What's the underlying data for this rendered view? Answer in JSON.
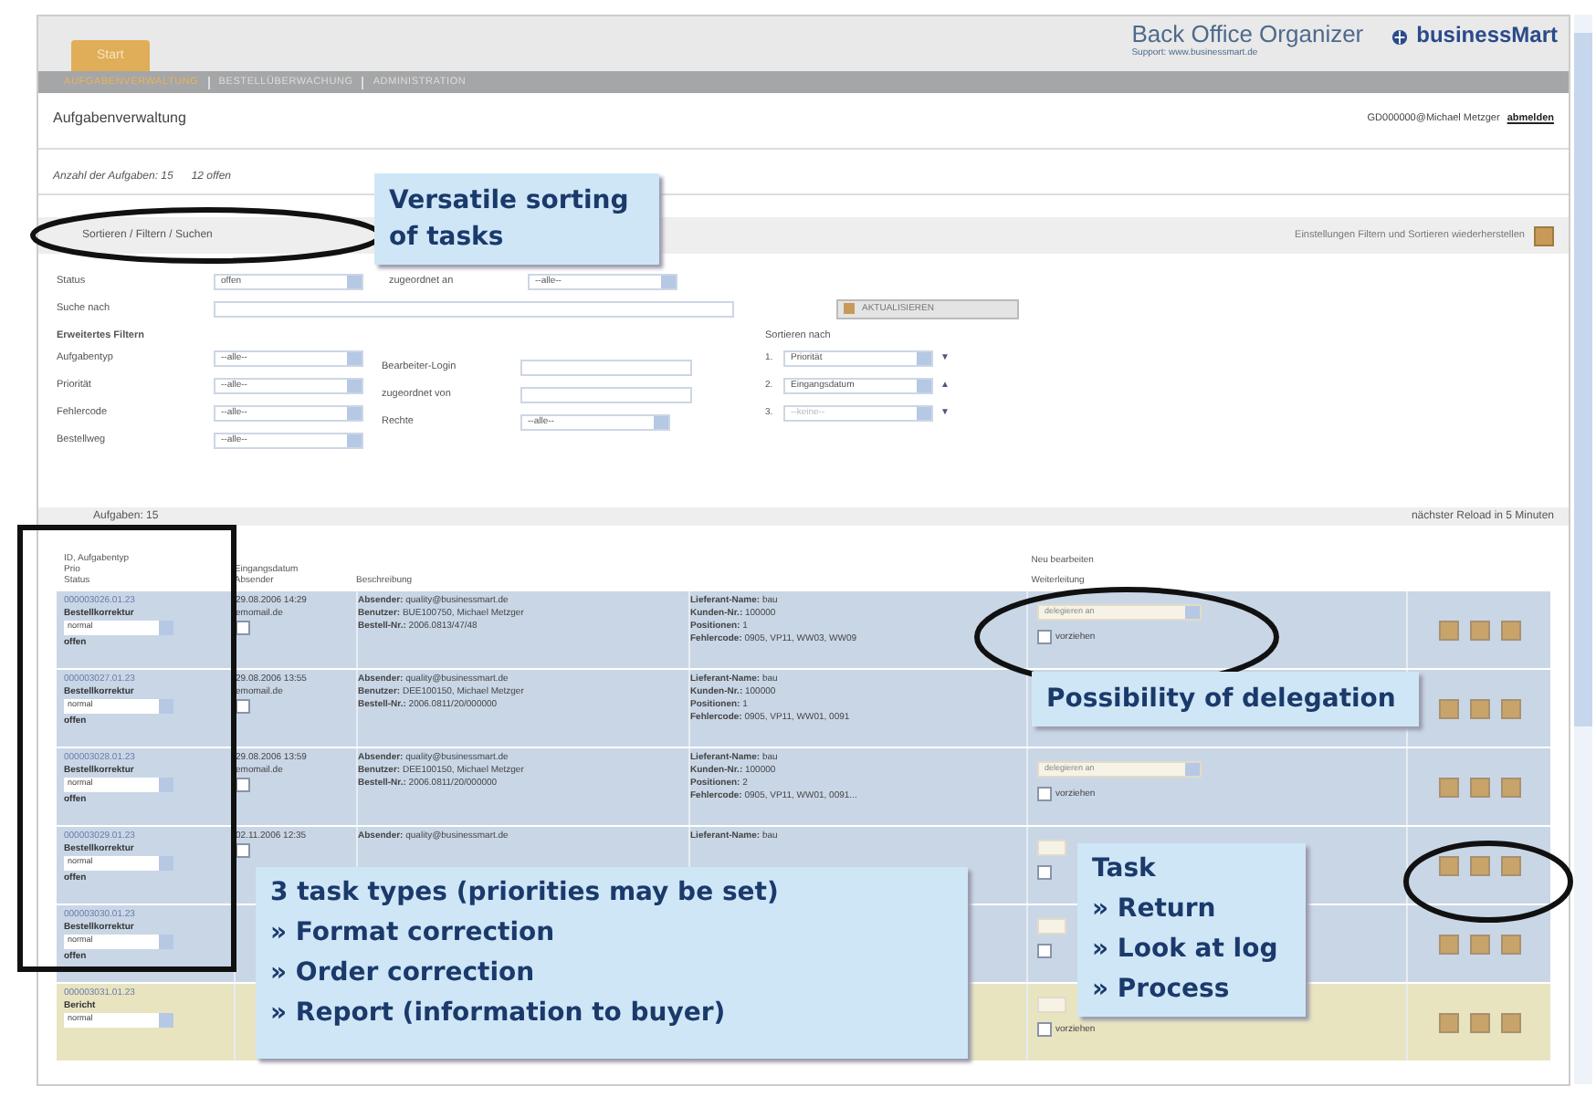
{
  "header": {
    "tab": "Start",
    "app_title": "Back Office Organizer",
    "subtitle": "Support: www.businessmart.de",
    "brand": "businessMart"
  },
  "nav": [
    {
      "label": "AUFGABENVERWALTUNG",
      "selected": true
    },
    {
      "label": "BESTELLÜBERWACHUNG",
      "selected": false
    },
    {
      "label": "ADMINISTRATION",
      "selected": false
    }
  ],
  "page_title": "Aufgabenverwaltung",
  "user": "GD000000@Michael Metzger",
  "logout": "abmelden",
  "summary": {
    "count": "Anzahl der Aufgaben: 15",
    "open": "12 offen"
  },
  "filter_panel": {
    "title": "Sortieren / Filtern / Suchen",
    "reset_link": "Einstellungen Filtern und Sortieren wiederherstellen",
    "status": {
      "label": "Status",
      "value": "offen"
    },
    "assigned": {
      "label": "zugeordnet an",
      "value": "--alle--"
    },
    "search_label": "Suche nach",
    "refresh_button": "AKTUALISIEREN",
    "advanced_title": "Erweitertes Filtern",
    "filters": [
      {
        "label": "Aufgabentyp",
        "value": "--alle--"
      },
      {
        "label": "Priorität",
        "value": "--alle--"
      },
      {
        "label": "Fehlercode",
        "value": "--alle--"
      },
      {
        "label": "Bestellweg",
        "value": "--alle--"
      }
    ],
    "middle_filters": [
      {
        "label": "Bearbeiter-Login",
        "kind": "text"
      },
      {
        "label": "zugeordnet von",
        "kind": "text"
      },
      {
        "label": "Rechte",
        "kind": "select",
        "value": "--alle--"
      }
    ],
    "sort_title": "Sortieren nach",
    "sort": [
      {
        "index": "1.",
        "value": "Priorität",
        "arrow": "▼",
        "disabled": false
      },
      {
        "index": "2.",
        "value": "Eingangsdatum",
        "arrow": "▲",
        "disabled": false
      },
      {
        "index": "3.",
        "value": "--keine--",
        "arrow": "▼",
        "disabled": true
      }
    ]
  },
  "list_bar": {
    "title": "Aufgaben: 15",
    "reload": "nächster Reload in 5 Minuten"
  },
  "columns": {
    "col1": [
      "ID, Aufgabentyp",
      "Prio",
      "Status"
    ],
    "col2": [
      "Eingangsdatum",
      "Absender"
    ],
    "col3": "Beschreibung",
    "col5": [
      "Neu bearbeiten",
      "Weiterleitung"
    ]
  },
  "rows": [
    {
      "id": "000003026.01.23",
      "type": "Bestellkorrektur",
      "priority": "normal",
      "status": "offen",
      "date": "29.08.2006 14:29",
      "source": "emomail.de",
      "sender": [
        "**Absender:** quality@businessmart.de",
        "**Benutzer:** BUE100750, Michael Metzger",
        "**Bestell-Nr.:** 2006.0813/47/48"
      ],
      "supplier": [
        "**Lieferant-Name:** bau",
        "**Kunden-Nr.:** 100000",
        "**Positionen:** 1",
        "**Fehlercode:** 0905, VP11, WW03, WW09"
      ],
      "delegate": "delegieren an",
      "check_label": "vorziehen",
      "checked": false,
      "highlighted": false
    },
    {
      "id": "000003027.01.23",
      "type": "Bestellkorrektur",
      "priority": "normal",
      "status": "offen",
      "date": "29.08.2006 13:55",
      "source": "emomail.de",
      "sender": [
        "**Absender:** quality@businessmart.de",
        "**Benutzer:** DEE100150, Michael Metzger",
        "**Bestell-Nr.:** 2006.0811/20/000000"
      ],
      "supplier": [
        "**Lieferant-Name:** bau",
        "**Kunden-Nr.:** 100000",
        "**Positionen:** 1",
        "**Fehlercode:** 0905, VP11, WW01, 0091"
      ],
      "highlighted": false
    },
    {
      "id": "000003028.01.23",
      "type": "Bestellkorrektur",
      "priority": "normal",
      "status": "offen",
      "date": "29.08.2006 13:59",
      "source": "emomail.de",
      "sender": [
        "**Absender:** quality@businessmart.de",
        "**Benutzer:** DEE100150, Michael Metzger",
        "**Bestell-Nr.:** 2006.0811/20/000000"
      ],
      "supplier": [
        "**Lieferant-Name:** bau",
        "**Kunden-Nr.:** 100000",
        "**Positionen:** 2",
        "**Fehlercode:** 0905, VP11, WW01, 0091..."
      ],
      "delegate": "delegieren an",
      "check_label": "vorziehen",
      "checked": false,
      "highlighted": false
    },
    {
      "id": "000003029.01.23",
      "type": "Bestellkorrektur",
      "priority": "normal",
      "status": "offen",
      "date": "02.11.2006 12:35",
      "sender": [
        "**Absender:** quality@businessmart.de"
      ],
      "supplier": [
        "**Lieferant-Name:** bau"
      ],
      "checked": false,
      "highlighted": false
    },
    {
      "id": "000003030.01.23",
      "type": "Bestellkorrektur",
      "priority": "normal",
      "status": "offen",
      "checked": false,
      "highlighted": false
    },
    {
      "id": "000003031.01.23",
      "type": "Bericht",
      "priority": "normal",
      "check_label": "vorziehen",
      "checked": false,
      "highlighted": true
    }
  ],
  "callouts": [
    {
      "lines": [
        "Versatile sorting",
        "of tasks"
      ]
    },
    {
      "lines": [
        "Possibility of delegation"
      ]
    },
    {
      "lines": [
        "3 task types (priorities may be set)",
        "» Format correction",
        "» Order correction",
        "» Report (information to buyer)"
      ]
    },
    {
      "lines": [
        "Task",
        "» Return",
        "» Look at log",
        "» Process"
      ]
    }
  ]
}
